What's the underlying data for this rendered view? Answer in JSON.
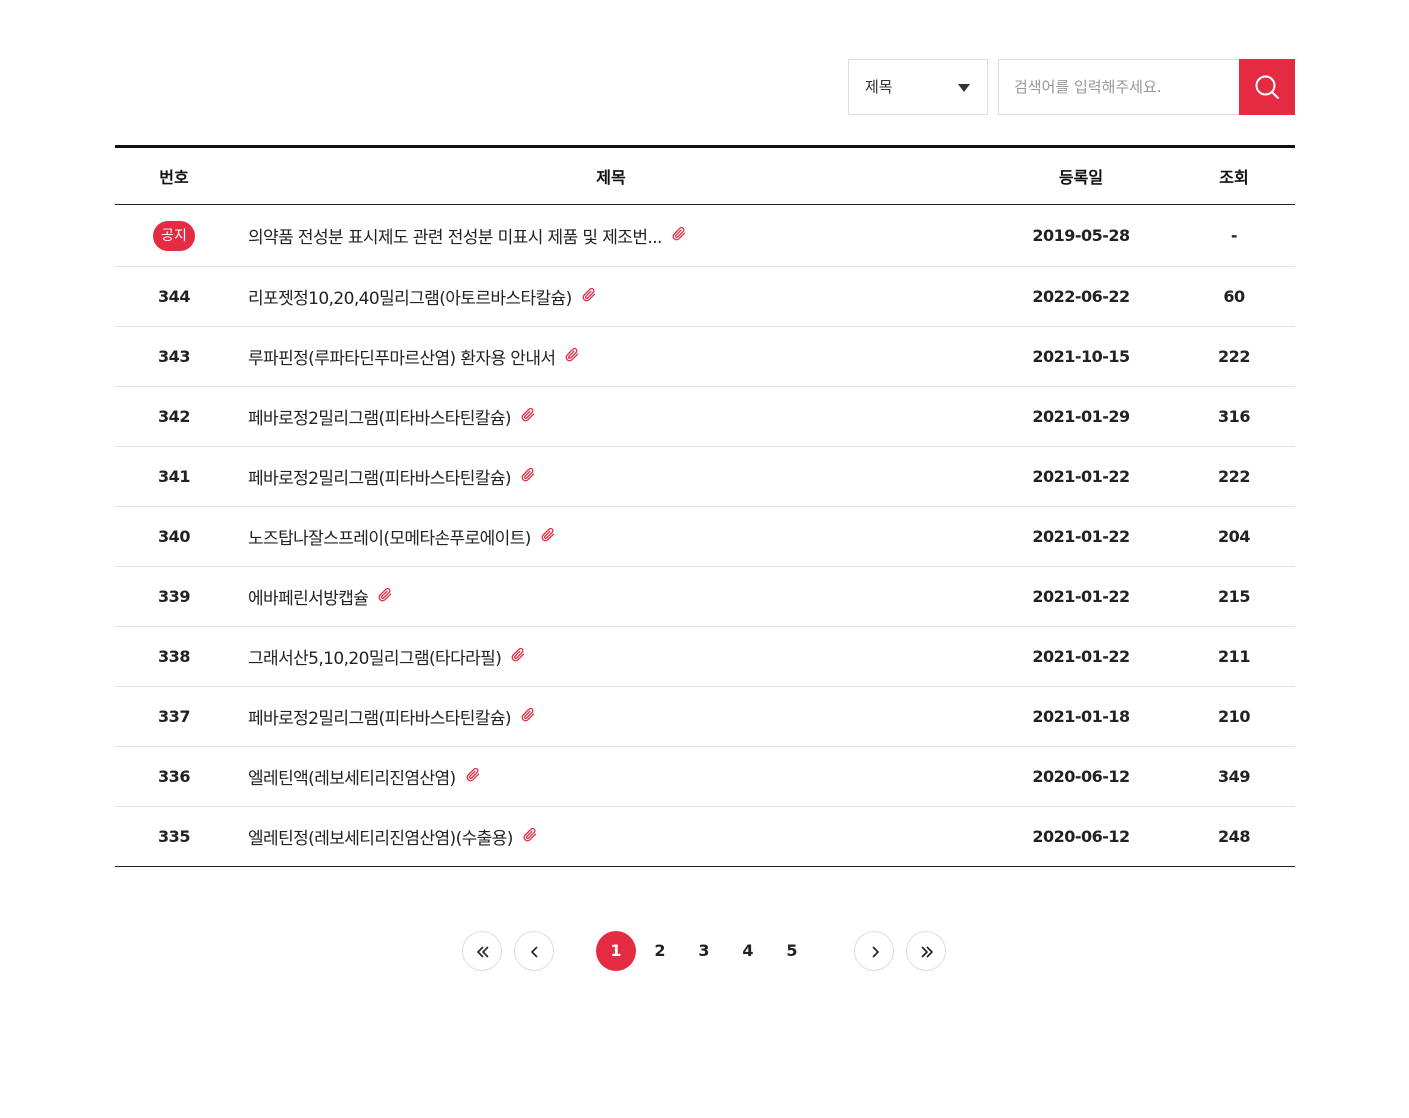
{
  "search": {
    "select_value": "제목",
    "placeholder": "검색어를 입력해주세요."
  },
  "table": {
    "headers": {
      "number": "번호",
      "title": "제목",
      "date": "등록일",
      "views": "조회"
    },
    "rows": [
      {
        "number": "공지",
        "title": "의약품 전성분 표시제도 관련 전성분 미표시 제품 및 제조번...",
        "date": "2019-05-28",
        "views": "-"
      },
      {
        "number": "344",
        "title": "리포젯정10,20,40밀리그램(아토르바스타칼슘)",
        "date": "2022-06-22",
        "views": "60"
      },
      {
        "number": "343",
        "title": "루파핀정(루파타딘푸마르산염) 환자용 안내서",
        "date": "2021-10-15",
        "views": "222"
      },
      {
        "number": "342",
        "title": "페바로정2밀리그램(피타바스타틴칼슘)",
        "date": "2021-01-29",
        "views": "316"
      },
      {
        "number": "341",
        "title": "페바로정2밀리그램(피타바스타틴칼슘)",
        "date": "2021-01-22",
        "views": "222"
      },
      {
        "number": "340",
        "title": "노즈탑나잘스프레이(모메타손푸로에이트)",
        "date": "2021-01-22",
        "views": "204"
      },
      {
        "number": "339",
        "title": "에바페린서방캡슐",
        "date": "2021-01-22",
        "views": "215"
      },
      {
        "number": "338",
        "title": "그래서산5,10,20밀리그램(타다라필)",
        "date": "2021-01-22",
        "views": "211"
      },
      {
        "number": "337",
        "title": "페바로정2밀리그램(피타바스타틴칼슘)",
        "date": "2021-01-18",
        "views": "210"
      },
      {
        "number": "336",
        "title": "엘레틴액(레보세티리진염산염)",
        "date": "2020-06-12",
        "views": "349"
      },
      {
        "number": "335",
        "title": "엘레틴정(레보세티리진염산염)(수출용)",
        "date": "2020-06-12",
        "views": "248"
      }
    ]
  },
  "pagination": {
    "pages": [
      "1",
      "2",
      "3",
      "4",
      "5"
    ],
    "current": "1"
  },
  "colors": {
    "accent": "#e42b42"
  },
  "icons": {
    "search": "search-icon",
    "attachment": "paperclip-icon",
    "first": "double-chevron-left-icon",
    "prev": "chevron-left-icon",
    "next": "chevron-right-icon",
    "last": "double-chevron-right-icon",
    "dropdown": "caret-down-icon"
  }
}
